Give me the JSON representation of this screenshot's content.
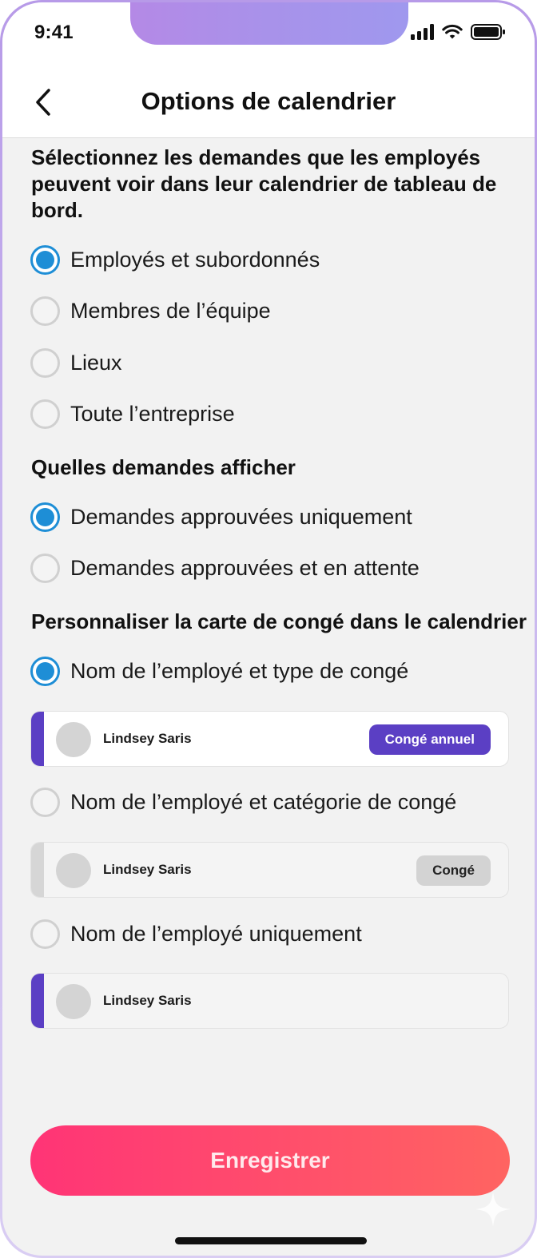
{
  "status_bar": {
    "time": "9:41"
  },
  "header": {
    "title": "Options de calendrier"
  },
  "sections": {
    "visibility_title": "Sélectionnez les demandes que les employés peuvent voir dans leur calendrier de tableau de bord.",
    "visibility_options": [
      {
        "label": "Employés et subordonnés",
        "selected": true
      },
      {
        "label": "Membres de l’équipe",
        "selected": false
      },
      {
        "label": "Lieux",
        "selected": false
      },
      {
        "label": "Toute l’entreprise",
        "selected": false
      }
    ],
    "requests_title": "Quelles demandes afficher",
    "requests_options": [
      {
        "label": "Demandes approuvées uniquement",
        "selected": true
      },
      {
        "label": "Demandes approuvées et en attente",
        "selected": false
      }
    ],
    "card_title": "Personnaliser la carte de congé dans le calendrier",
    "card_options": [
      {
        "label": "Nom de l’employé et type de congé",
        "selected": true,
        "preview": {
          "name": "Lindsey Saris",
          "badge": "Congé annuel",
          "badge_color": "#5b3fc4",
          "badge_text_color": "#ffffff",
          "stripe_color": "#5b3fc4",
          "card_bg": "#ffffff"
        }
      },
      {
        "label": "Nom de l’employé et catégorie de congé",
        "selected": false,
        "preview": {
          "name": "Lindsey Saris",
          "badge": "Congé",
          "badge_color": "#d3d3d3",
          "badge_text_color": "#222222",
          "stripe_color": "#d6d6d6",
          "card_bg": "#f4f4f4"
        }
      },
      {
        "label": "Nom de l’employé uniquement",
        "selected": false,
        "preview": {
          "name": "Lindsey Saris",
          "stripe_color": "#5b3fc4",
          "card_bg": "#f4f4f4"
        }
      }
    ]
  },
  "footer": {
    "save_label": "Enregistrer"
  },
  "colors": {
    "accent": "#1e8ed6",
    "primary_gradient_start": "#ff3476",
    "primary_gradient_end": "#ff6461",
    "leave_purple": "#5b3fc4"
  }
}
